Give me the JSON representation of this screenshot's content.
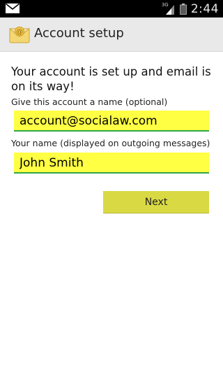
{
  "status_bar": {
    "time": "2:44",
    "network_type": "3G",
    "icons": [
      "email-notification-icon",
      "signal-icon",
      "battery-icon"
    ]
  },
  "header": {
    "title": "Account setup",
    "icon": "email-app-icon"
  },
  "main": {
    "headline": "Your account is set up and email is on its way!",
    "account_name_label": "Give this account a name (optional)",
    "account_name_value": "account@socialaw.com",
    "your_name_label": "Your name (displayed on outgoing messages)",
    "your_name_value": "John Smith",
    "next_label": "Next"
  },
  "colors": {
    "field_background": "#ffff44",
    "field_underline": "#2ea84a",
    "button_background": "#d9d944",
    "title_bar_background": "#e9e9e9"
  }
}
